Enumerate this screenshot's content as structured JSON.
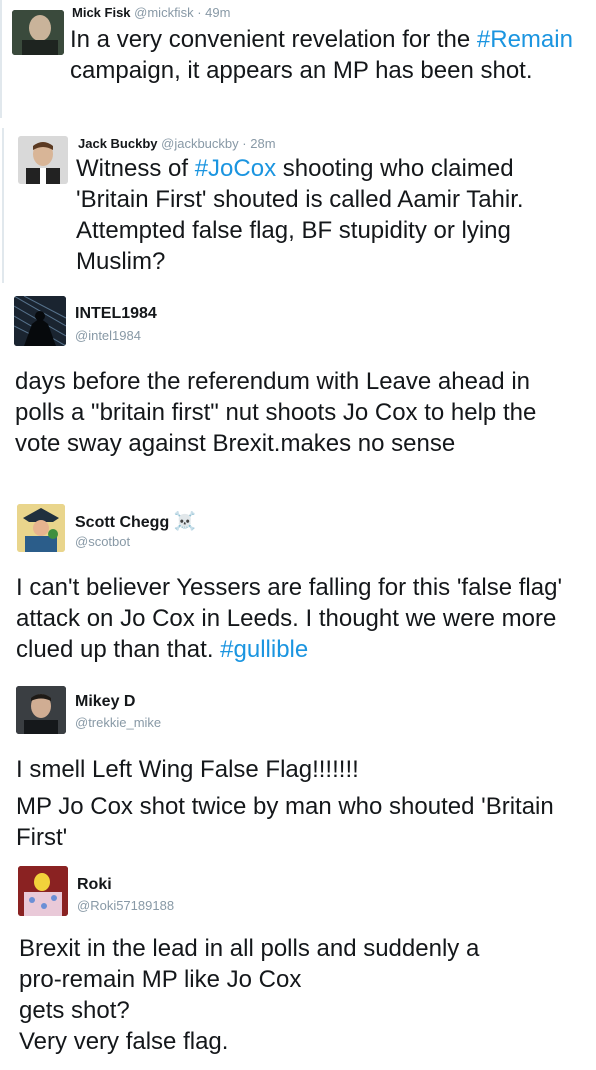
{
  "tweets": [
    {
      "name": "Mick Fisk",
      "handle": "@mickfisk",
      "time": "49m",
      "text_before": "In a very convenient revelation for the ",
      "hashtag": "#Remain",
      "text_after": " campaign, it appears an MP has been shot."
    },
    {
      "name": "Jack Buckby",
      "handle": "@jackbuckby",
      "time": "28m",
      "text_before": "Witness of ",
      "hashtag": "#JoCox",
      "text_after": " shooting who claimed 'Britain First' shouted is called Aamir Tahir. Attempted false flag, BF stupidity or lying Muslim?"
    },
    {
      "name": "INTEL1984",
      "handle": "@intel1984",
      "text": "days before the referendum with Leave ahead in polls a \"britain first\" nut shoots Jo Cox to help the vote sway against Brexit.makes no sense"
    },
    {
      "name": "Scott Chegg",
      "name_emoji": "☠️",
      "handle": "@scotbot",
      "text_before": "I can't believer Yessers are falling for this 'false flag' attack on Jo Cox in Leeds. I thought we were more clued up than that. ",
      "hashtag": "#gullible"
    },
    {
      "name": "Mikey D",
      "handle": "@trekkie_mike",
      "line1": "I smell Left Wing False Flag!!!!!!!",
      "line2": "MP Jo Cox shot twice by man who shouted 'Britain First'"
    },
    {
      "name": "Roki",
      "handle": "@Roki57189188",
      "line1": "Brexit in the lead in all polls and suddenly a",
      "line2": "pro-remain MP like Jo Cox",
      "line3": "gets shot?",
      "line4": "Very very false flag."
    }
  ],
  "separator": "·",
  "colors": {
    "hashtag": "#1b95e0",
    "handle": "#8899a6",
    "text": "#14171a"
  }
}
